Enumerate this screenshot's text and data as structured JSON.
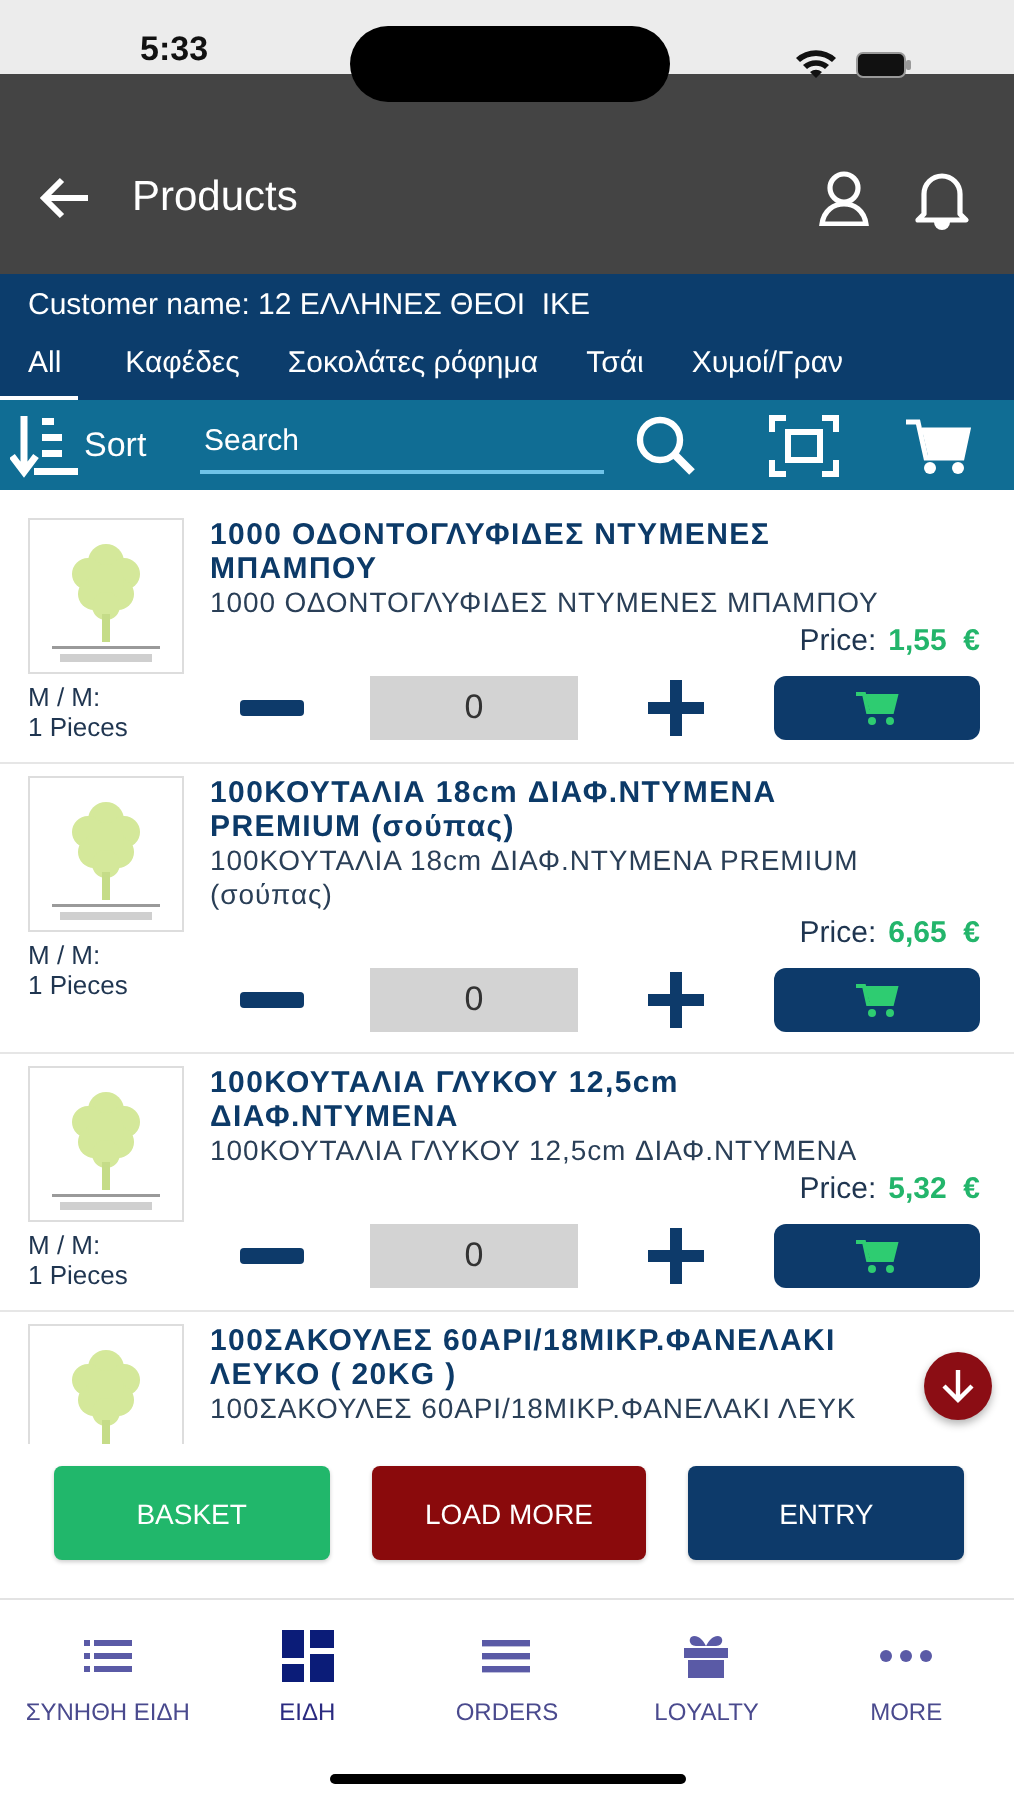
{
  "status_bar": {
    "time": "5:33"
  },
  "header": {
    "title": "Products"
  },
  "customer": {
    "text": "Customer name: 12 ΕΛΛΗΝΕΣ ΘΕΟΙ  ΙΚΕ"
  },
  "tabs": [
    {
      "label": "All",
      "selected": true
    },
    {
      "label": "Καφέδες",
      "selected": false
    },
    {
      "label": "Σοκολάτες ρόφημα",
      "selected": false
    },
    {
      "label": "Τσάι",
      "selected": false
    },
    {
      "label": "Χυμοί/Γραν",
      "selected": false
    }
  ],
  "toolbar": {
    "sort_label": "Sort",
    "search": {
      "placeholder": "Search"
    }
  },
  "products": [
    {
      "title": "1000 ΟΔΟΝΤΟΓΛΥΦΙΔΕΣ ΝΤΥΜΕΝΕΣ ΜΠΑΜΠΟΥ",
      "description": "1000 ΟΔΟΝΤΟΓΛΥΦΙΔΕΣ ΝΤΥΜΕΝΕΣ ΜΠΑΜΠΟΥ",
      "unit_label": "M / M:",
      "unit": "1 Pieces",
      "price_label": "Price:",
      "price": "1,55  €",
      "quantity": "0"
    },
    {
      "title": "100ΚΟΥΤΑΛΙΑ 18cm ΔΙΑΦ.ΝΤΥΜΕΝΑ PREMIUM (σούπας)",
      "description": "100ΚΟΥΤΑΛΙΑ 18cm ΔΙΑΦ.ΝΤΥΜΕΝΑ PREMIUM (σούπας)",
      "unit_label": "M / M:",
      "unit": "1 Pieces",
      "price_label": "Price:",
      "price": "6,65  €",
      "quantity": "0"
    },
    {
      "title": "100ΚΟΥΤΑΛΙΑ ΓΛΥΚΟΥ 12,5cm ΔΙΑΦ.ΝΤΥΜΕΝΑ",
      "description": "100ΚΟΥΤΑΛΙΑ ΓΛΥΚΟΥ 12,5cm ΔΙΑΦ.ΝΤΥΜΕΝΑ",
      "unit_label": "M / M:",
      "unit": "1 Pieces",
      "price_label": "Price:",
      "price": "5,32  €",
      "quantity": "0"
    },
    {
      "title": "100ΣΑΚΟΥΛΕΣ 60ΑΡΙ/18ΜΙΚΡ.ΦΑΝΕΛΑΚΙ ΛΕΥΚΟ ( 20KG )",
      "description": "100ΣΑΚΟΥΛΕΣ 60ΑΡΙ/18ΜΙΚΡ.ΦΑΝΕΛΑΚΙ ΛΕΥΚ"
    }
  ],
  "actions": [
    {
      "kind": "basket",
      "label": "BASKET"
    },
    {
      "kind": "load_more",
      "label": "LOAD MORE"
    },
    {
      "kind": "entry",
      "label": "ENTRY"
    }
  ],
  "nav": [
    {
      "kind": "list",
      "label": "ΣΥΝΗΘΗ ΕΙΔΗ",
      "selected": false
    },
    {
      "kind": "grid",
      "label": "ΕΙΔΗ",
      "selected": true
    },
    {
      "kind": "menu",
      "label": "ORDERS",
      "selected": false
    },
    {
      "kind": "gift",
      "label": "LOYALTY",
      "selected": false
    },
    {
      "kind": "more",
      "label": "MORE",
      "selected": false
    }
  ]
}
